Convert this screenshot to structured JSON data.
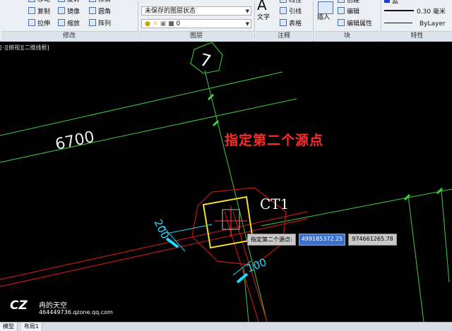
{
  "ribbon": {
    "modify": {
      "label": "修改",
      "items": [
        "移动",
        "旋转",
        "修剪",
        "复制",
        "镜像",
        "圆角",
        "拉伸",
        "缩放",
        "阵列"
      ]
    },
    "layer": {
      "label": "图层",
      "state_value": "未保存的图层状态",
      "current_layer": "0"
    },
    "annotation": {
      "label": "注释",
      "text_label": "文字",
      "items": [
        "线性",
        "引线",
        "表格"
      ]
    },
    "block": {
      "label": "块",
      "insert_label": "插入",
      "items": [
        "创建",
        "编辑",
        "编辑属性"
      ]
    },
    "properties": {
      "label": "特性",
      "color_value": "蓝",
      "lineweight_value": "0.30 毫米",
      "linetype_value": "ByLayer"
    }
  },
  "viewport": {
    "label": "[-][俯视][二维线框]"
  },
  "drawing": {
    "grid_bubble": "7",
    "dim_long": "6700",
    "dim_200": "200",
    "dim_100": "100",
    "column_tag": "CT1",
    "annotation_text": "指定第二个源点"
  },
  "prompt": {
    "label": "指定第二个源点:",
    "x_value": "499185372.25",
    "y_value": "974661265.78"
  },
  "watermark": {
    "logo": "CZ",
    "title": "冉的天空",
    "url": "464449736.qzone.qq.com"
  },
  "tabs": [
    "模型",
    "布局1"
  ],
  "colors": {
    "background": "#000000",
    "axis_green": "#3fcf3f",
    "red_lines": "#c01818",
    "yellow_box": "#f2e02a",
    "cyan_dims": "#22d8ff",
    "annotation_red": "#ff2a2a",
    "highlight_blue": "#3b6fd0"
  }
}
